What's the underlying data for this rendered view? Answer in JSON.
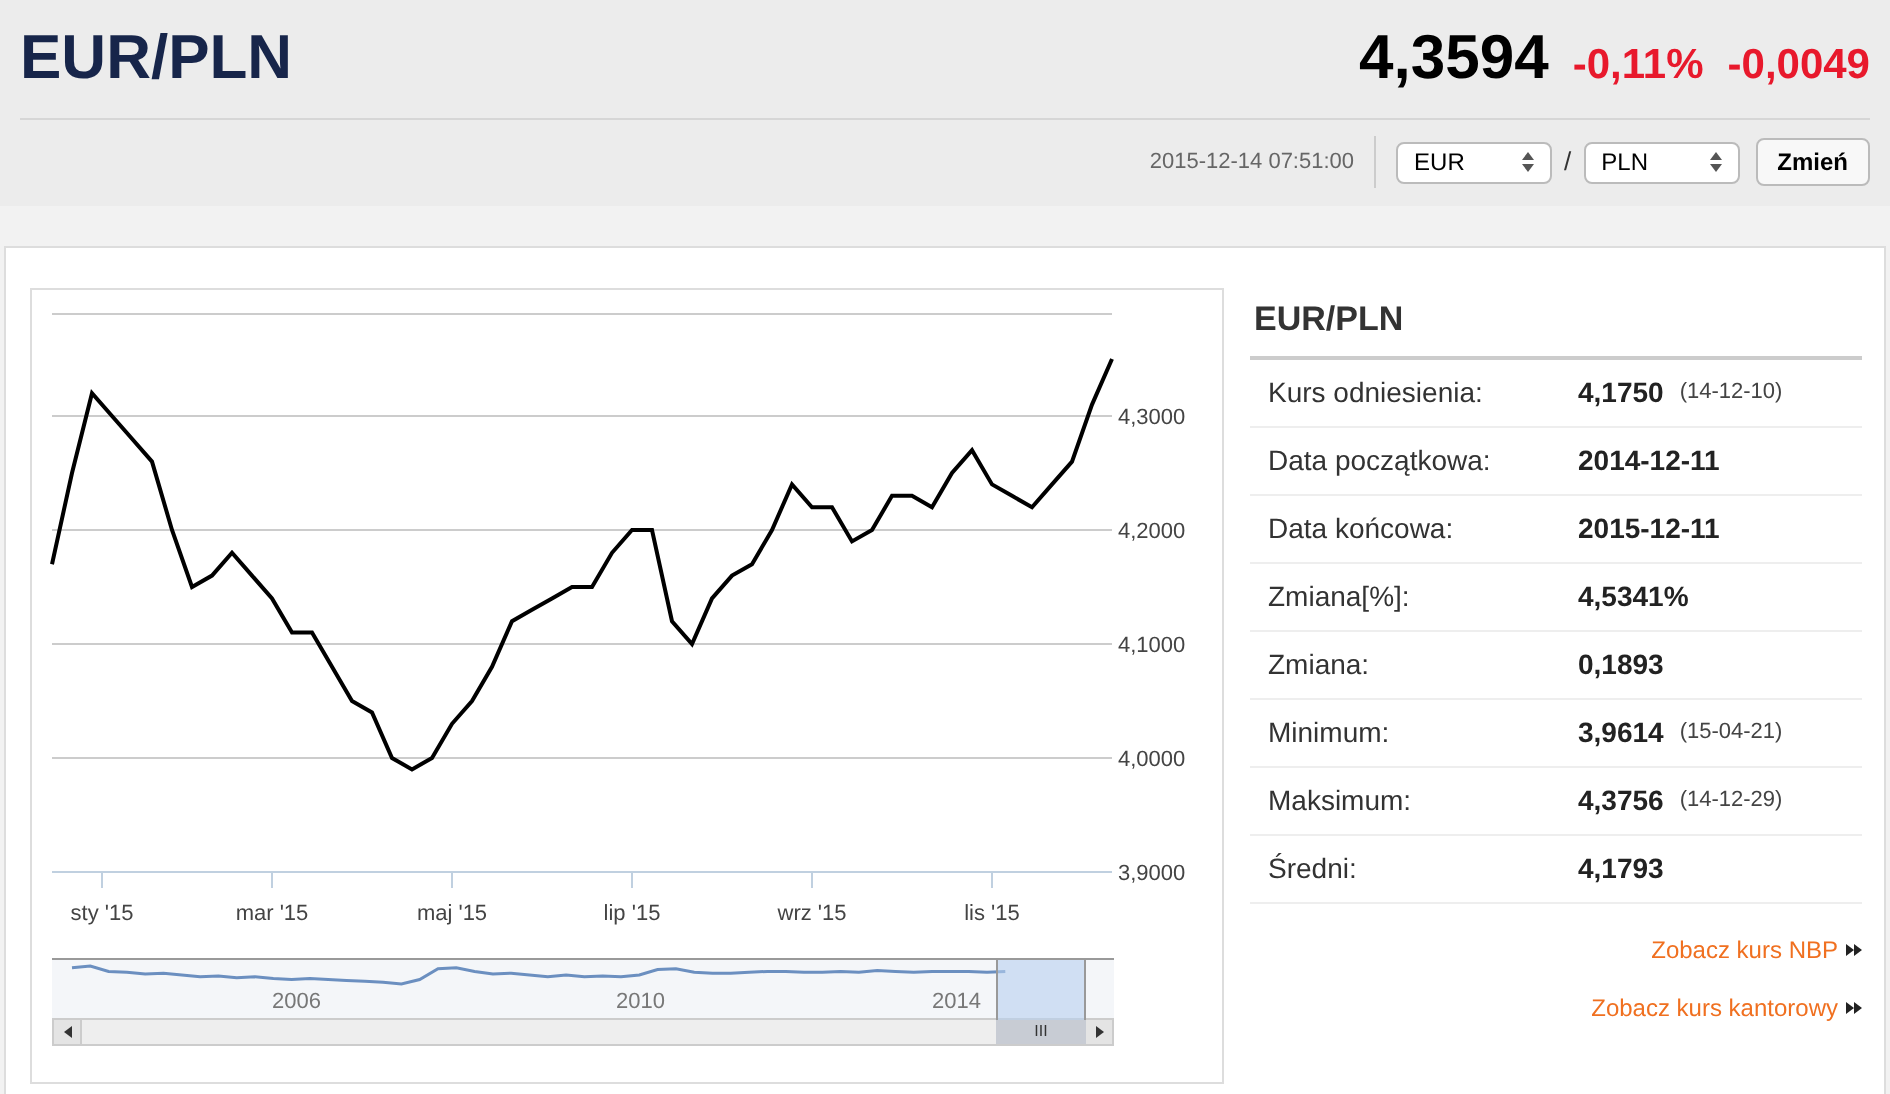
{
  "header": {
    "title": "EUR/PLN",
    "price": "4,3594",
    "change_percent": "-0,11%",
    "change_value": "-0,0049",
    "timestamp": "2015-12-14 07:51:00",
    "base_select": "EUR",
    "separator": "/",
    "quote_select": "PLN",
    "button": "Zmień"
  },
  "chart": {
    "y_axis_labels": [
      "4,3000",
      "4,2000",
      "4,1000",
      "4,0000",
      "3,9000"
    ],
    "x_axis_labels": [
      "sty '15",
      "mar '15",
      "maj '15",
      "lip '15",
      "wrz '15",
      "lis '15"
    ],
    "navigator_labels": [
      "2006",
      "2010",
      "2014"
    ],
    "scrollbar_grip": "III"
  },
  "summary": {
    "title": "EUR/PLN",
    "rows": [
      {
        "label": "Kurs odniesienia:",
        "value": "4,1750",
        "note": "(14-12-10)"
      },
      {
        "label": "Data początkowa:",
        "value": "2014-12-11"
      },
      {
        "label": "Data końcowa:",
        "value": "2015-12-11"
      },
      {
        "label": "Zmiana[%]:",
        "value": "4,5341%"
      },
      {
        "label": "Zmiana:",
        "value": "0,1893"
      },
      {
        "label": "Minimum:",
        "value": "3,9614",
        "note": "(15-04-21)"
      },
      {
        "label": "Maksimum:",
        "value": "4,3756",
        "note": "(14-12-29)"
      },
      {
        "label": "Średni:",
        "value": "4,1793"
      }
    ],
    "links": [
      "Zobacz kurs NBP",
      "Zobacz kurs kantorowy"
    ]
  }
}
